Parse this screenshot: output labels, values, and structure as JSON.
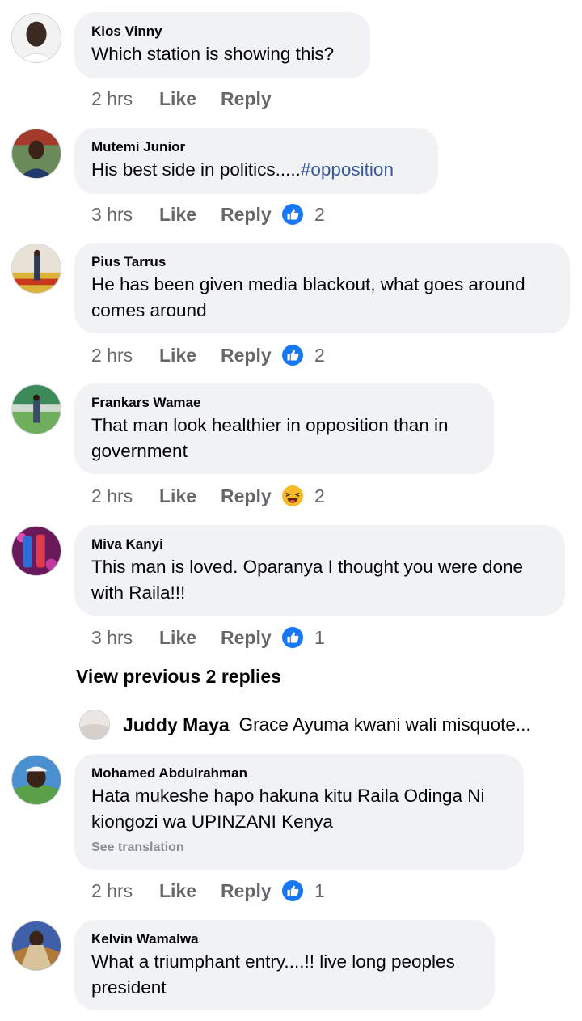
{
  "labels": {
    "like": "Like",
    "reply": "Reply"
  },
  "comments": [
    {
      "author": "Kios Vinny",
      "text": "Which station is showing this?",
      "time": "2 hrs",
      "reaction_icon": "like-icon",
      "reactions": ""
    },
    {
      "author": "Mutemi Junior",
      "text": "His best side in politics.....",
      "hashtag": "#opposition",
      "time": "3 hrs",
      "reaction_icon": "like-icon",
      "reactions": "2"
    },
    {
      "author": "Pius Tarrus",
      "text_line1": "He has been given media blackout, what goes around",
      "text_line2": "comes around",
      "time": "2 hrs",
      "reaction_icon": "like-icon",
      "reactions": "2"
    },
    {
      "author": "Frankars Wamae",
      "text_line1": "That man look healthier in opposition than in",
      "text_line2": "government",
      "time": "2 hrs",
      "reaction_icon": "haha-icon",
      "reactions": "2"
    },
    {
      "author": "Miva Kanyi",
      "text_line1": "This man is loved. Oparanya I thought you were done",
      "text_line2": "with Raila!!!",
      "time": "3 hrs",
      "reaction_icon": "like-icon",
      "reactions": "1"
    },
    {
      "author": "Mohamed Abdulrahman",
      "text_line1": "Hata mukeshe hapo hakuna kitu Raila Odinga Ni",
      "text_line2": "kiongozi wa UPINZANI Kenya",
      "see_translation": "See translation",
      "time": "2 hrs",
      "reaction_icon": "like-icon",
      "reactions": "1"
    },
    {
      "author": "Kelvin Wamalwa",
      "text_line1": "What a triumphant entry....!! live long peoples",
      "text_line2": "president"
    }
  ],
  "view_previous": "View previous 2 replies",
  "collapsed_reply": {
    "author": "Juddy Maya",
    "text": "Grace Ayuma kwani wali misquote..."
  },
  "colors": {
    "bubble": "#f0f2f5",
    "meta": "#65676b",
    "hashtag": "#385898",
    "like_blue": "#1877f2"
  }
}
